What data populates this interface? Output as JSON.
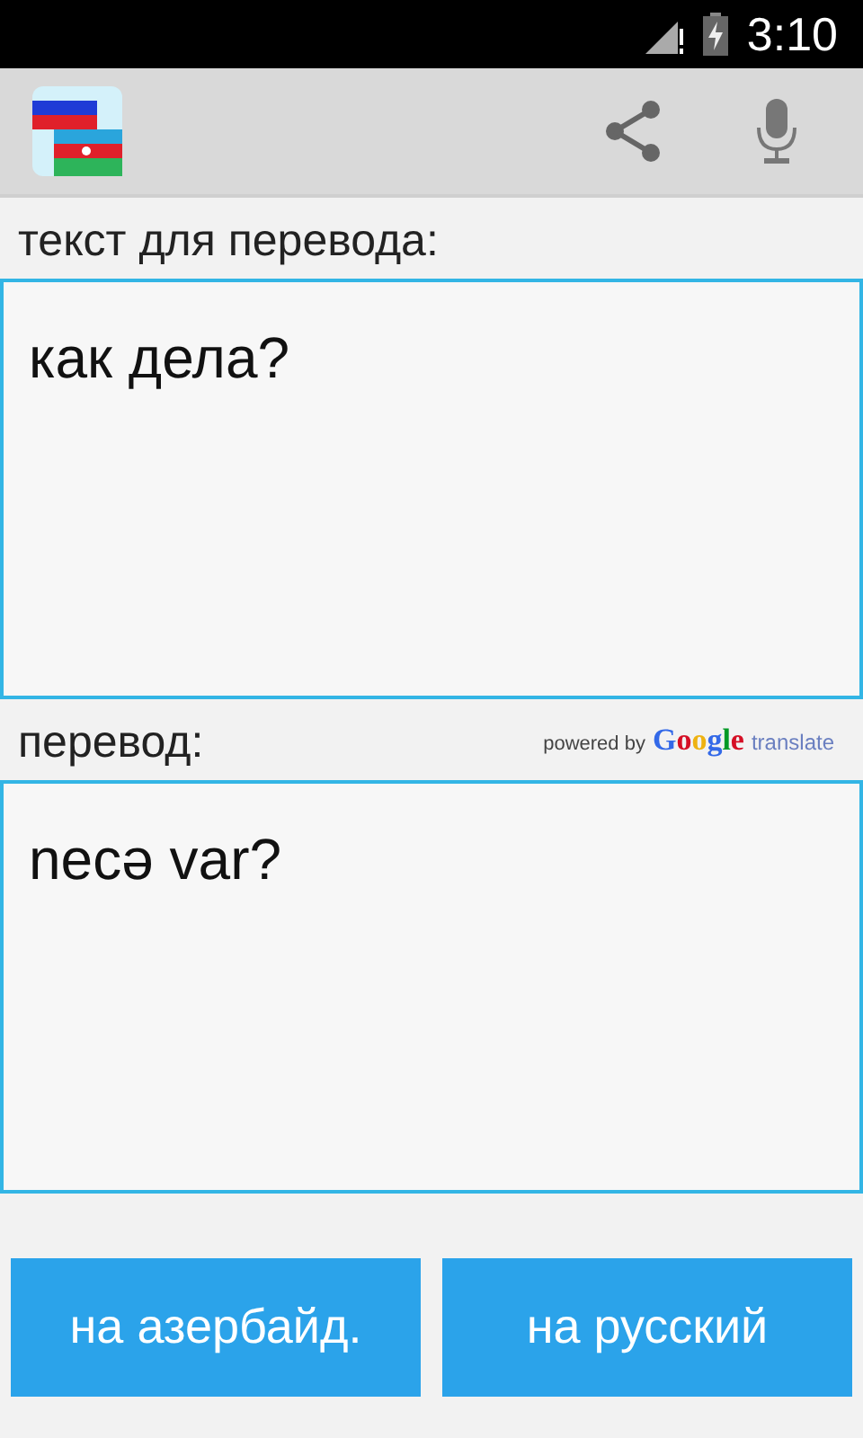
{
  "status_bar": {
    "time": "3:10"
  },
  "source": {
    "label": "текст для перевода:",
    "value": "как дела?"
  },
  "result": {
    "label": "перевод:",
    "value": "necə var?",
    "attribution": {
      "prefix": "powered by",
      "brand": "Google",
      "service": "translate"
    }
  },
  "buttons": [
    {
      "label": "на азербайд."
    },
    {
      "label": "на русский"
    }
  ]
}
